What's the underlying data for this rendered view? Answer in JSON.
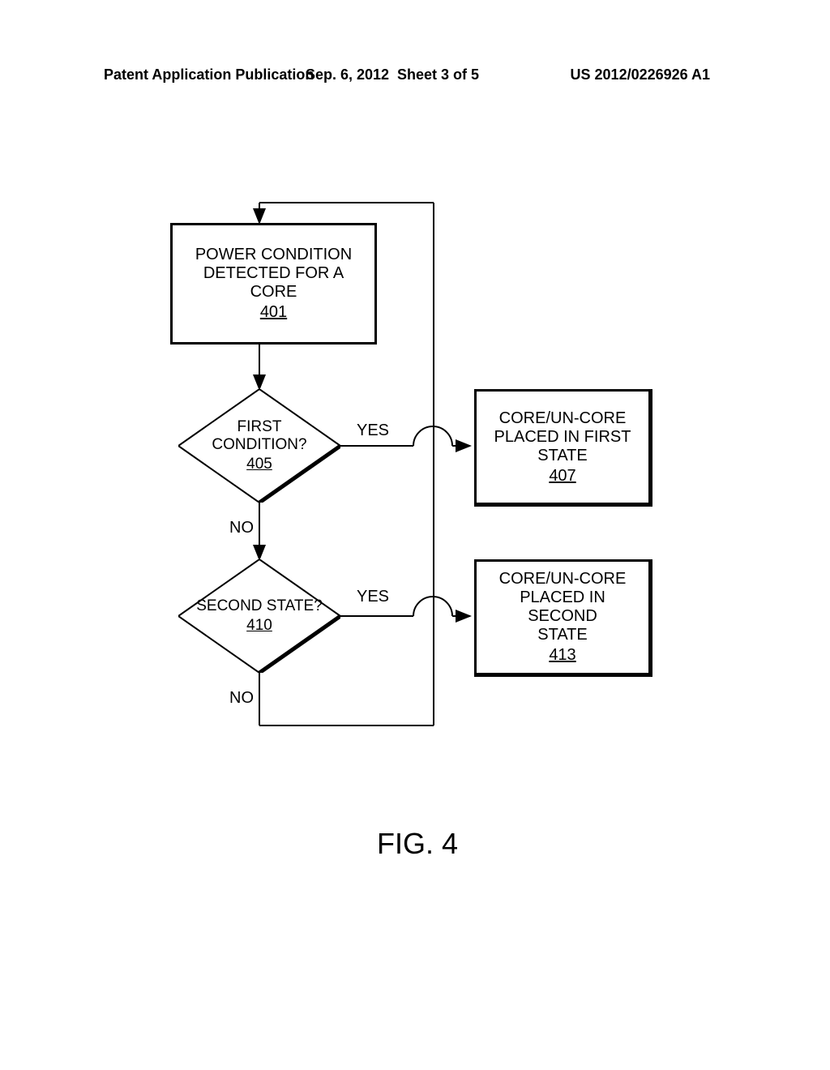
{
  "header": {
    "pub_type": "Patent Application Publication",
    "date": "Sep. 6, 2012",
    "sheet": "Sheet 3 of 5",
    "pub_num": "US 2012/0226926 A1"
  },
  "flowchart": {
    "step401": {
      "line1": "POWER CONDITION",
      "line2": "DETECTED FOR A CORE",
      "ref": "401"
    },
    "decision405": {
      "line1": "FIRST",
      "line2": "CONDITION?",
      "ref": "405",
      "yes": "YES",
      "no": "NO"
    },
    "step407": {
      "line1": "CORE/UN-CORE",
      "line2": "PLACED IN FIRST",
      "line3": "STATE",
      "ref": "407"
    },
    "decision410": {
      "line1": "SECOND STATE?",
      "ref": "410",
      "yes": "YES",
      "no": "NO"
    },
    "step413": {
      "line1": "CORE/UN-CORE",
      "line2": "PLACED IN SECOND",
      "line3": "STATE",
      "ref": "413"
    }
  },
  "figure_label": "FIG. 4"
}
